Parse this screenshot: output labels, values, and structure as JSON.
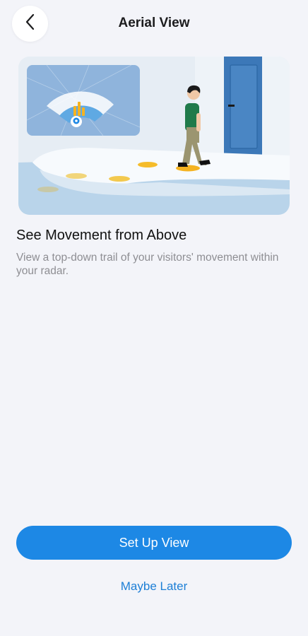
{
  "header": {
    "title": "Aerial View",
    "back_icon": "chevron-left-icon"
  },
  "hero": {
    "illustration": "person-walking-radar-trail-illustration"
  },
  "content": {
    "title": "See Movement from Above",
    "description": "View a top-down trail of your visitors' movement within your radar."
  },
  "actions": {
    "primary_label": "Set Up View",
    "secondary_label": "Maybe Later"
  },
  "colors": {
    "background": "#f3f4f9",
    "primary": "#1d88e5",
    "link": "#1d7fd6",
    "muted_text": "#8e8e93"
  }
}
